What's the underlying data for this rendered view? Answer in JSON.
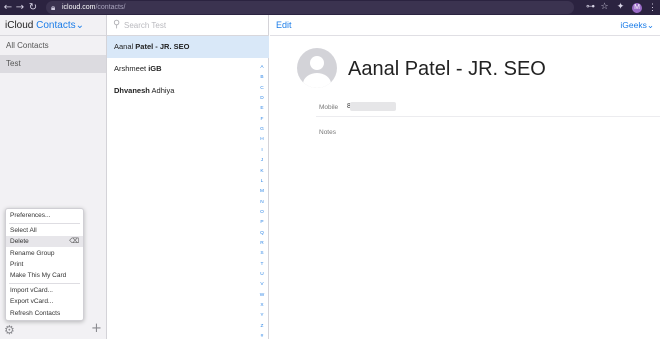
{
  "browser": {
    "url_host": "icloud.com",
    "url_path": "/contacts/",
    "profile_initial": "M",
    "nav": [
      "←",
      "→",
      "↻"
    ],
    "right_icons": [
      "⊶",
      "☆",
      "✦"
    ]
  },
  "sidebar": {
    "app_name": "iCloud",
    "app_section": "Contacts",
    "chevron": "⌄",
    "groups": [
      "All Contacts",
      "Test"
    ],
    "gear_glyph": "⚙",
    "plus_glyph": "+"
  },
  "menu": {
    "items": [
      "Preferences...",
      "Select All",
      "Delete",
      "Rename Group",
      "Print",
      "Make This My Card",
      "Import vCard...",
      "Export vCard...",
      "Refresh Contacts"
    ],
    "delete_key_glyph": "⌫"
  },
  "list": {
    "search_placeholder": "Search Test",
    "contacts": [
      {
        "first": "Aanal",
        "last": "Patel - JR. SEO"
      },
      {
        "first": "Arshmeet",
        "last": "iGB"
      },
      {
        "first": "Dhvanesh",
        "last": "Adhiya"
      }
    ],
    "index": [
      "A",
      "B",
      "C",
      "D",
      "E",
      "F",
      "G",
      "H",
      "I",
      "J",
      "K",
      "L",
      "M",
      "N",
      "O",
      "P",
      "Q",
      "R",
      "S",
      "T",
      "U",
      "V",
      "W",
      "X",
      "Y",
      "Z",
      "#"
    ]
  },
  "detail": {
    "edit_label": "Edit",
    "account_label": "iGeeks",
    "name": "Aanal Patel - JR. SEO",
    "mobile_label": "Mobile",
    "mobile_value": "8",
    "notes_label": "Notes"
  }
}
